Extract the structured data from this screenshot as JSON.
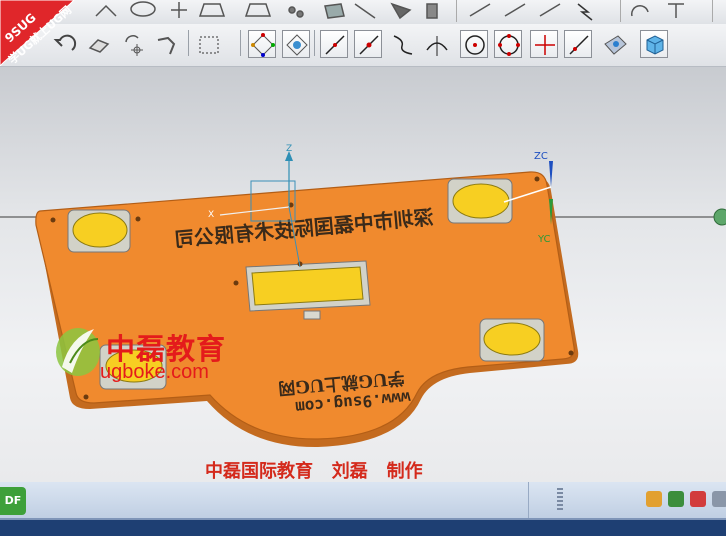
{
  "toolbar_top": {
    "items": [
      "arc-icon",
      "circle-icon",
      "plus-icon",
      "shape-icon",
      "shape-outline-icon",
      "points-icon",
      "cube-icon",
      "line-icon",
      "solid-icon",
      "cylinder-icon",
      "draw-icon",
      "draw-icon-2",
      "draw-icon-3",
      "lightning-icon",
      "rotate-icon",
      "text-icon"
    ]
  },
  "toolbar_main": {
    "items": [
      {
        "name": "undo-icon"
      },
      {
        "name": "eraser-icon"
      },
      {
        "name": "rotate-point-icon"
      },
      {
        "name": "snap-icon"
      },
      {
        "name": "select-box-icon"
      },
      {
        "name": "snap-points-icon"
      },
      {
        "name": "snap-settings-icon"
      },
      {
        "name": "line-snap-icon"
      },
      {
        "name": "midpoint-snap-icon"
      },
      {
        "name": "curve-snap-icon"
      },
      {
        "name": "intersection-snap-icon"
      },
      {
        "name": "center-snap-icon"
      },
      {
        "name": "quadrant-snap-icon"
      },
      {
        "name": "point-snap-icon"
      },
      {
        "name": "tangent-snap-icon"
      },
      {
        "name": "face-snap-icon"
      },
      {
        "name": "view-cube-icon"
      }
    ]
  },
  "watermark": {
    "line1": "9SUG",
    "line2": "学UG就上UG网"
  },
  "model": {
    "engraved_text_1": "深圳市中磊国际技术有限公司",
    "engraved_text_2": "学UG就上UG网",
    "engraved_text_3": "www.9sug.com",
    "color": "#f08a2e",
    "pad_color": "#f7cf22"
  },
  "axes": {
    "zc": "ZC",
    "yc": "YC",
    "z": "Z",
    "x": "X"
  },
  "brand": {
    "cn": "中磊教育",
    "url": "ugboke.com"
  },
  "credit": "中磊国际教育   刘磊   制作",
  "taskbar": {
    "start_label": "DF"
  }
}
